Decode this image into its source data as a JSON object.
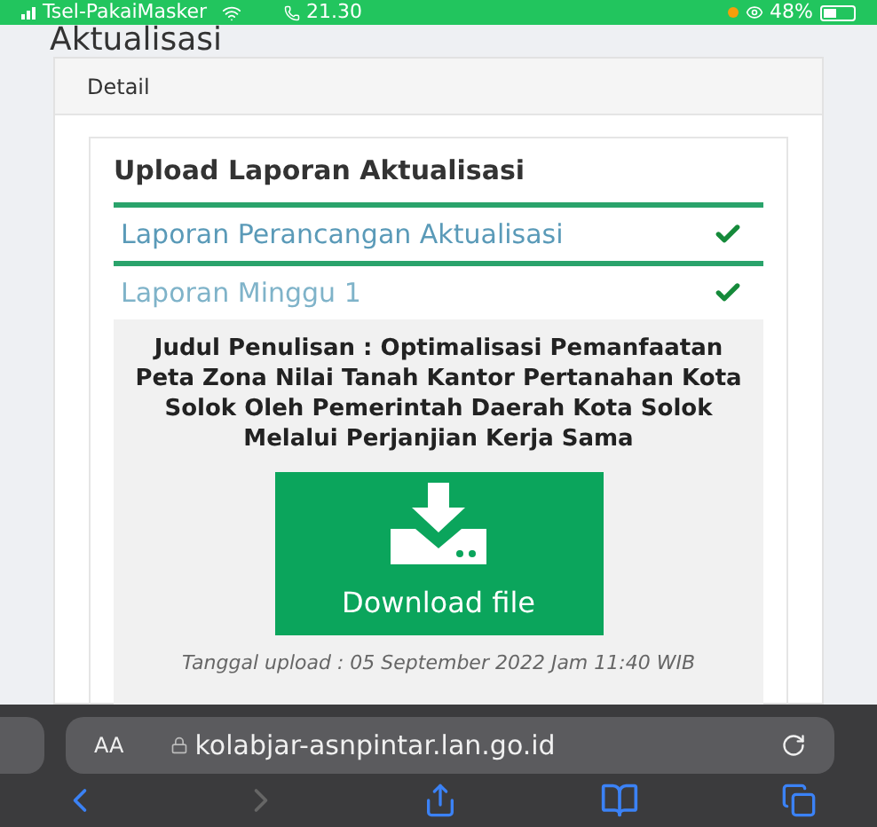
{
  "status_bar": {
    "carrier": "Tsel-PakaiMasker",
    "time": "21.30",
    "battery": "48%"
  },
  "page_title": "Aktualisasi",
  "card": {
    "header": "Detail",
    "section_title": "Upload Laporan Aktualisasi",
    "items": [
      {
        "label": "Laporan Perancangan Aktualisasi",
        "done": true,
        "expanded": false
      },
      {
        "label": "Laporan Minggu 1",
        "done": true,
        "expanded": true,
        "body": {
          "title": "Judul Penulisan : Optimalisasi Pemanfaatan Peta Zona Nilai Tanah Kantor Pertanahan Kota Solok Oleh Pemerintah Daerah Kota Solok Melalui Perjanjian Kerja Sama",
          "button": "Download file",
          "upload_date": "Tanggal upload : 05 September 2022 Jam 11:40 WIB"
        }
      }
    ]
  },
  "browser": {
    "text_size": "AA",
    "url": "kolabjar-asnpintar.lan.go.id",
    "back_disabled": false,
    "forward_disabled": true
  }
}
